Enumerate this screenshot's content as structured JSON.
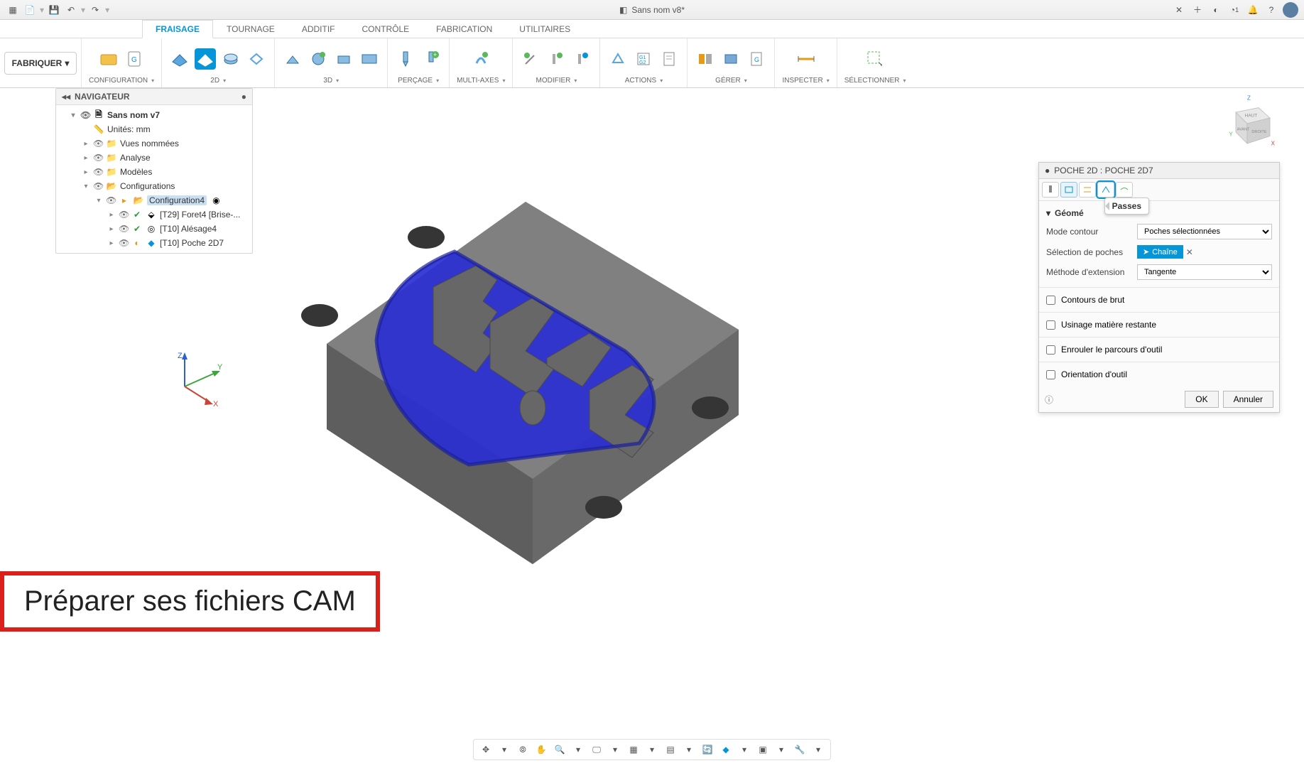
{
  "qat": {
    "title": "Sans nom v8*",
    "jobs_badge": "1"
  },
  "ribbon": {
    "fabriquer": "FABRIQUER",
    "tabs": [
      "FRAISAGE",
      "TOURNAGE",
      "ADDITIF",
      "CONTRÔLE",
      "FABRICATION",
      "UTILITAIRES"
    ],
    "active_tab": 0,
    "groups": {
      "configuration": "CONFIGURATION",
      "g2d": "2D",
      "g3d": "3D",
      "percage": "PERÇAGE",
      "multiaxes": "MULTI-AXES",
      "modifier": "MODIFIER",
      "actions": "ACTIONS",
      "gerer": "GÉRER",
      "inspecter": "INSPECTER",
      "selectionner": "SÉLECTIONNER"
    }
  },
  "browser": {
    "title": "NAVIGATEUR",
    "root": "Sans nom v7",
    "units": "Unités: mm",
    "named_views": "Vues nommées",
    "analysis": "Analyse",
    "models": "Modèles",
    "configs": "Configurations",
    "config_active": "Configuration4",
    "ops": [
      {
        "name": "[T29] Foret4 [Brise-...",
        "status": "ok"
      },
      {
        "name": "[T10] Alésage4",
        "status": "ok"
      },
      {
        "name": "[T10] Poche 2D7",
        "status": "warn"
      }
    ]
  },
  "panel": {
    "title": "POCHE 2D : POCHE 2D7",
    "section": "Géomé",
    "tooltip": "Passes",
    "mode_contour": {
      "label": "Mode contour",
      "value": "Poches sélectionnées"
    },
    "selection": {
      "label": "Sélection de poches",
      "chip": "Chaîne"
    },
    "extension": {
      "label": "Méthode d'extension",
      "value": "Tangente"
    },
    "checks": [
      "Contours de brut",
      "Usinage matière restante",
      "Enrouler le parcours d'outil",
      "Orientation d'outil"
    ],
    "ok": "OK",
    "cancel": "Annuler"
  },
  "caption": "Préparer ses fichiers CAM",
  "viewcube": {
    "top": "HAUT",
    "front": "AVANT",
    "right": "DROITE",
    "axes": {
      "x": "X",
      "y": "Y",
      "z": "Z"
    }
  },
  "triad": {
    "x": "X",
    "y": "Y",
    "z": "Z"
  }
}
